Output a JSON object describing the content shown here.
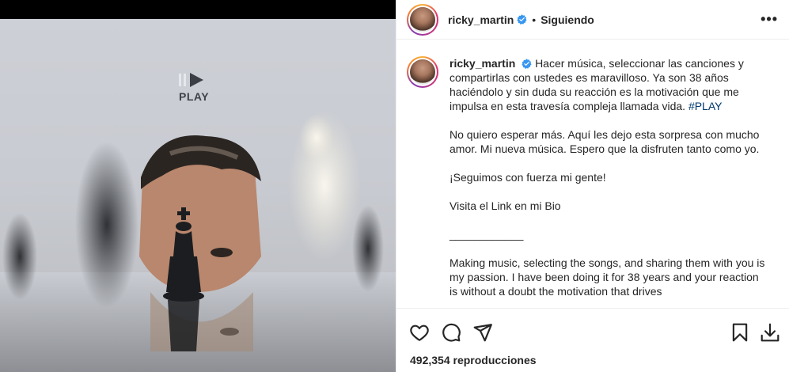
{
  "post": {
    "username": "ricky_martin",
    "follow_status": "Siguiendo",
    "separator": "•",
    "more_label": "•••",
    "media": {
      "logo_text": "PLAY"
    },
    "caption": {
      "username": "ricky_martin",
      "p1": "Hacer música, seleccionar las canciones y compartirlas con ustedes es maravilloso. Ya son 38 años haciéndolo y sin duda su reacción es la motivación que me impulsa en esta travesía compleja llamada vida.",
      "hashtag": "#PLAY",
      "p2": "No quiero esperar más. Aquí les dejo esta sorpresa con mucho amor. Mi nueva música. Espero que la disfruten tanto como yo.",
      "p3": "¡Seguimos con fuerza mi gente!",
      "p4": "Visita el Link en mi Bio",
      "p5": "____________",
      "p6": "Making music, selecting the songs, and sharing them with you is my passion. I have been doing it for 38 years and your reaction is without a doubt the motivation that drives"
    },
    "views": "492,354 reproducciones",
    "icons": {
      "like": "heart-icon",
      "comment": "comment-icon",
      "share": "send-icon",
      "save": "bookmark-icon",
      "download": "download-icon",
      "verified": "verified-badge-icon"
    },
    "colors": {
      "verified": "#3897f0",
      "hashtag": "#00376b",
      "text": "#262626"
    }
  }
}
